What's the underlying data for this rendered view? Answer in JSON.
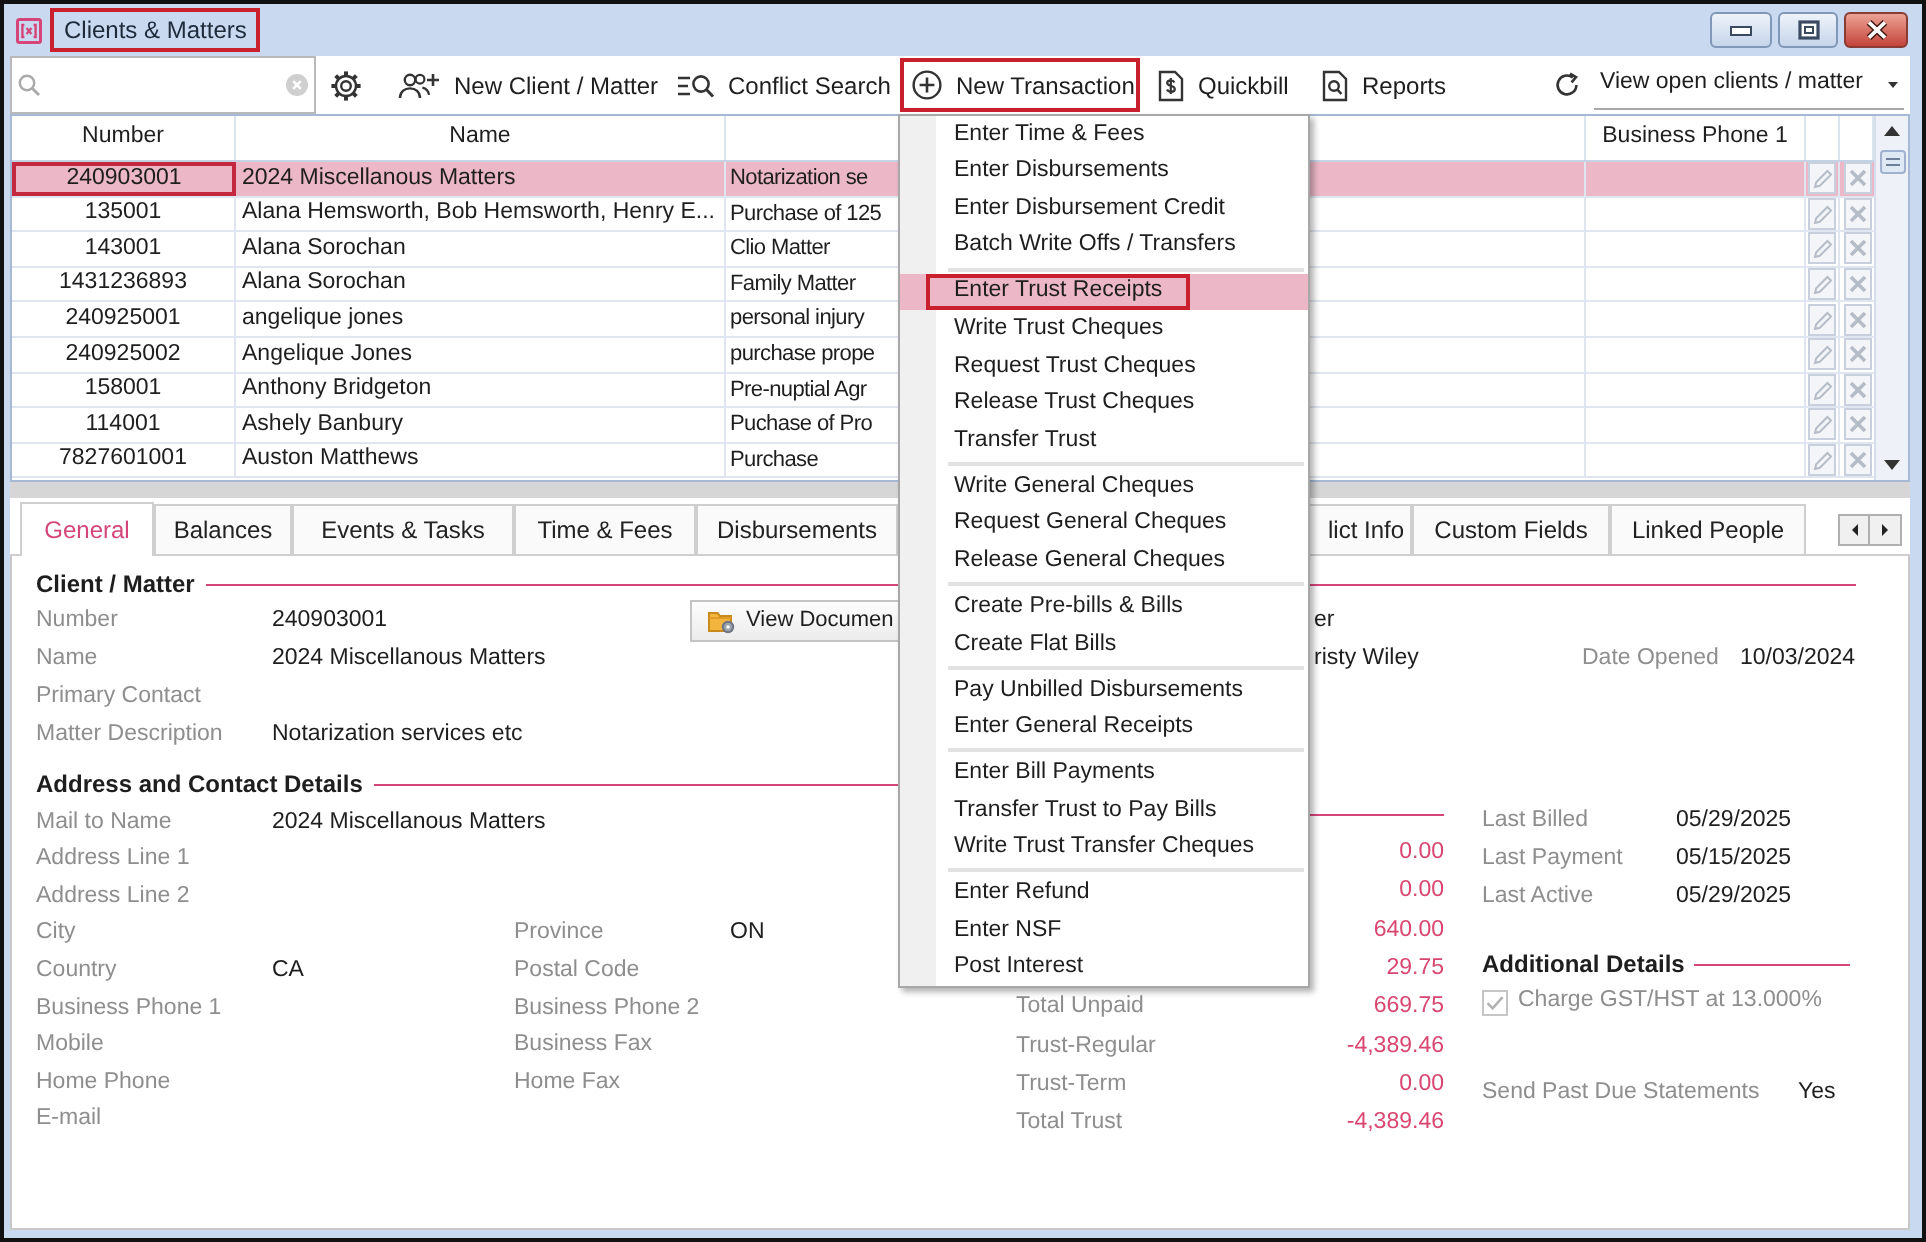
{
  "window": {
    "title": "Clients & Matters",
    "outlined": true
  },
  "toolbar": {
    "buttons": [
      {
        "label": "New Client / Matter",
        "outlined": false
      },
      {
        "label": "Conflict Search",
        "outlined": false
      },
      {
        "label": "New Transaction",
        "outlined": true
      },
      {
        "label": "Quickbill",
        "outlined": false
      },
      {
        "label": "Reports",
        "outlined": false
      }
    ],
    "view_filter": "View open clients / matter"
  },
  "table": {
    "columns": [
      "Number",
      "Name",
      "Business Phone 1"
    ],
    "rows": [
      {
        "number": "240903001",
        "name": "2024 Miscellanous Matters",
        "column_3": "Notarization se",
        "selected": true,
        "focused": true
      },
      {
        "number": "135001",
        "name": "Alana Hemsworth, Bob Hemsworth, Henry E...",
        "column_3": "Purchase of 125",
        "selected": false,
        "focused": false
      },
      {
        "number": "143001",
        "name": "Alana Sorochan",
        "column_3": "Clio Matter",
        "selected": false,
        "focused": false
      },
      {
        "number": "1431236893",
        "name": "Alana Sorochan",
        "column_3": "Family Matter",
        "selected": false,
        "focused": false
      },
      {
        "number": "240925001",
        "name": "angelique jones",
        "column_3": "personal injury",
        "selected": false,
        "focused": false
      },
      {
        "number": "240925002",
        "name": "Angelique Jones",
        "column_3": "purchase prope",
        "selected": false,
        "focused": false
      },
      {
        "number": "158001",
        "name": "Anthony Bridgeton",
        "column_3": "Pre-nuptial Agr",
        "selected": false,
        "focused": false
      },
      {
        "number": "114001",
        "name": "Ashely Banbury",
        "column_3": "Puchase of Pro",
        "selected": false,
        "focused": false
      },
      {
        "number": "7827601001",
        "name": "Auston Matthews",
        "column_3": "Purchase",
        "selected": false,
        "focused": false
      }
    ]
  },
  "menu": {
    "groups": [
      {
        "items": [
          {
            "label": "Enter Time & Fees",
            "selected": false,
            "outlined": false
          },
          {
            "label": "Enter Disbursements",
            "selected": false,
            "outlined": false
          },
          {
            "label": "Enter Disbursement Credit",
            "selected": false,
            "outlined": false
          },
          {
            "label": "Batch Write Offs / Transfers",
            "selected": false,
            "outlined": false
          }
        ]
      },
      {
        "items": [
          {
            "label": "Enter Trust Receipts",
            "selected": true,
            "outlined": true
          },
          {
            "label": "Write Trust Cheques",
            "selected": false,
            "outlined": false
          },
          {
            "label": "Request Trust Cheques",
            "selected": false,
            "outlined": false
          },
          {
            "label": "Release Trust Cheques",
            "selected": false,
            "outlined": false
          },
          {
            "label": "Transfer Trust",
            "selected": false,
            "outlined": false
          }
        ]
      },
      {
        "items": [
          {
            "label": "Write General Cheques",
            "selected": false,
            "outlined": false
          },
          {
            "label": "Request General Cheques",
            "selected": false,
            "outlined": false
          },
          {
            "label": "Release General Cheques",
            "selected": false,
            "outlined": false
          }
        ]
      },
      {
        "items": [
          {
            "label": "Create Pre-bills & Bills",
            "selected": false,
            "outlined": false
          },
          {
            "label": "Create Flat Bills",
            "selected": false,
            "outlined": false
          }
        ]
      },
      {
        "items": [
          {
            "label": "Pay Unbilled Disbursements",
            "selected": false,
            "outlined": false
          },
          {
            "label": "Enter General Receipts",
            "selected": false,
            "outlined": false
          }
        ]
      },
      {
        "items": [
          {
            "label": "Enter Bill Payments",
            "selected": false,
            "outlined": false
          },
          {
            "label": "Transfer Trust to Pay Bills",
            "selected": false,
            "outlined": false
          },
          {
            "label": "Write Trust Transfer Cheques",
            "selected": false,
            "outlined": false
          }
        ]
      },
      {
        "items": [
          {
            "label": "Enter Refund",
            "selected": false,
            "outlined": false
          },
          {
            "label": "Enter NSF",
            "selected": false,
            "outlined": false
          },
          {
            "label": "Post Interest",
            "selected": false,
            "outlined": false
          }
        ]
      }
    ]
  },
  "tabs": [
    {
      "label": "General",
      "selected": true
    },
    {
      "label": "Balances",
      "selected": false
    },
    {
      "label": "Events & Tasks",
      "selected": false
    },
    {
      "label": "Time & Fees",
      "selected": false
    },
    {
      "label": "Disbursements",
      "selected": false
    },
    {
      "label": "lict Info",
      "selected": false
    },
    {
      "label": "Custom Fields",
      "selected": false
    },
    {
      "label": "Linked People",
      "selected": false
    }
  ],
  "client_matter": {
    "heading": "Client / Matter",
    "rows": [
      {
        "label": "Number",
        "value": "240903001",
        "column_3": "er"
      },
      {
        "label": "Name",
        "value": "2024 Miscellanous Matters",
        "column_3": "risty Wiley",
        "column_4": {
          "label": "Date Opened",
          "value": "10/03/2024"
        }
      },
      {
        "label": "Primary Contact"
      },
      {
        "label": "Matter Description",
        "value": "Notarization services etc"
      }
    ],
    "view_documents_button": "View Documen"
  },
  "address": {
    "heading": "Address and Contact Details",
    "rows": [
      {
        "left": {
          "label": "Mail to Name",
          "value": "2024 Miscellanous Matters"
        }
      },
      {
        "left": {
          "label": "Address Line 1"
        }
      },
      {
        "left": {
          "label": "Address Line 2"
        }
      },
      {
        "left": {
          "label": "City"
        },
        "right": {
          "label": "Province",
          "value": "ON"
        }
      },
      {
        "left": {
          "label": "Country",
          "value": "CA"
        },
        "right": {
          "label": "Postal Code"
        }
      },
      {
        "left": {
          "label": "Business Phone 1"
        },
        "right": {
          "label": "Business Phone 2"
        }
      },
      {
        "left": {
          "label": "Mobile"
        },
        "right": {
          "label": "Business Fax"
        }
      },
      {
        "left": {
          "label": "Home Phone"
        },
        "right": {
          "label": "Home Fax"
        }
      },
      {
        "left": {
          "label": "E-mail"
        }
      }
    ]
  },
  "balances": [
    {
      "value": "0.00"
    },
    {
      "value": "0.00"
    },
    {
      "value": "640.00"
    },
    {
      "value": "29.75"
    },
    {
      "label": "Total Unpaid",
      "value": "669.75"
    },
    {
      "label": "Trust-Regular",
      "value": "-4,389.46"
    },
    {
      "label": "Trust-Term",
      "value": "0.00"
    },
    {
      "label": "Total Trust",
      "value": "-4,389.46"
    }
  ],
  "activity": [
    {
      "label": "Last Billed",
      "value": "05/29/2025"
    },
    {
      "label": "Last Payment",
      "value": "05/15/2025"
    },
    {
      "label": "Last Active",
      "value": "05/29/2025"
    }
  ],
  "additional_details": {
    "heading": "Additional Details",
    "checkbox": {
      "label": "Charge GST/HST at 13.000%",
      "checked": true,
      "disabled": true
    },
    "fields": [
      {
        "label": "Send Past Due Statements",
        "value": "Yes"
      }
    ]
  }
}
